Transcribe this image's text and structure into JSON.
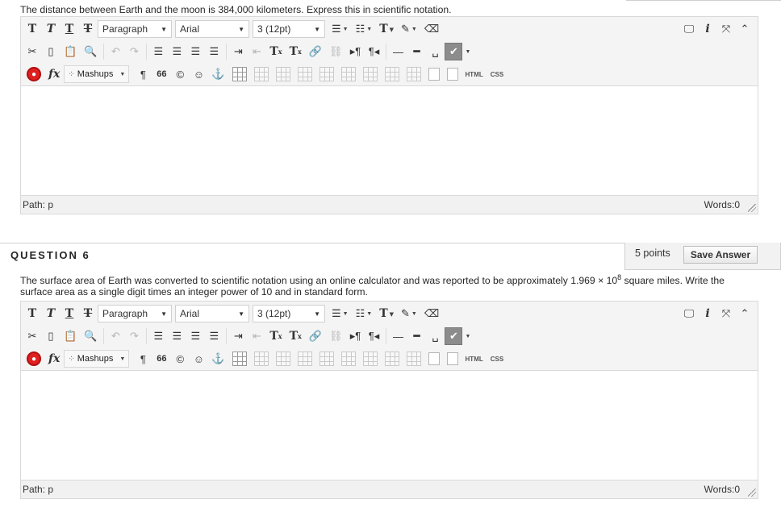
{
  "question5": {
    "text": "The distance between Earth and the moon is 384,000 kilometers. Express this in scientific notation."
  },
  "question6": {
    "title": "QUESTION 6",
    "points": "5 points",
    "save_label": "Save Answer",
    "text_part1": "The surface area of Earth was converted to scientific notation using an online calculator and was reported to be approximately 1.969 × 10",
    "text_sup": "8",
    "text_part2": " square miles. Write the surface area as a single digit times an integer power of 10 and in standard form."
  },
  "editor": {
    "paragraph_label": "Paragraph",
    "font_label": "Arial",
    "size_label": "3 (12pt)",
    "mashups_label": "Mashups",
    "html_label": "HTML",
    "css_label": "CSS",
    "path_label": "Path: p",
    "words_label": "Words:0",
    "glyphs": {
      "bold": "T",
      "italic": "T",
      "underline": "T",
      "strike": "T",
      "textcolor": "T",
      "superscript": "T",
      "subscript": "T",
      "paragraph": "¶",
      "quote": "66",
      "copyright": "©",
      "smiley": "☺",
      "anchor": "⚓",
      "fx": "fx"
    }
  },
  "colors": {
    "toolbar_bg": "#f4f4f4",
    "border": "#d9d9d9",
    "spellcheck_bg": "#8c8c8c",
    "noicon_red": "#e02020"
  }
}
